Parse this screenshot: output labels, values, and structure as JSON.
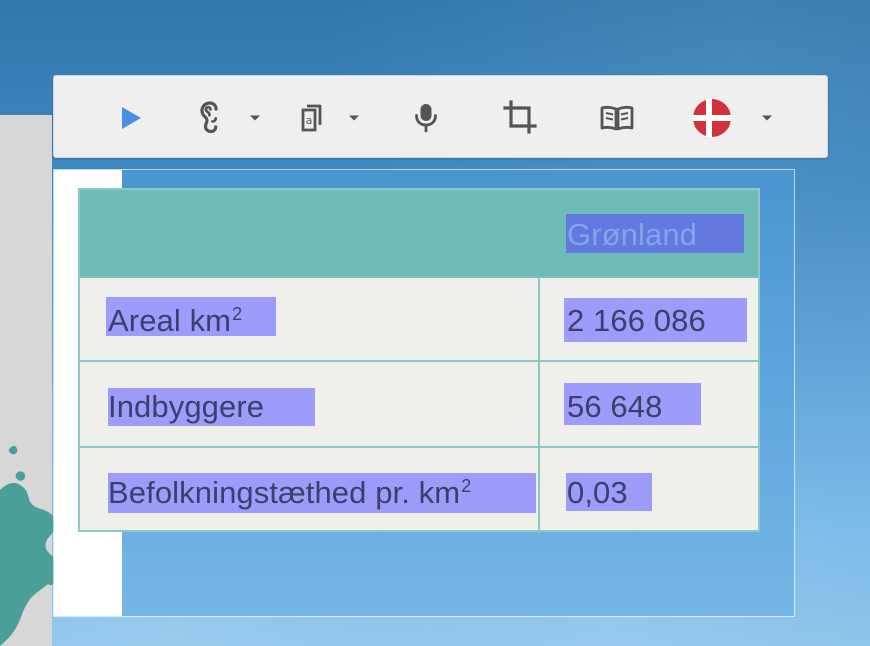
{
  "toolbar": {
    "buttons": [
      {
        "name": "play",
        "icon": "play-icon"
      },
      {
        "name": "hearing",
        "icon": "ear-icon"
      },
      {
        "name": "text-view",
        "icon": "text-document-icon"
      },
      {
        "name": "microphone",
        "icon": "microphone-icon"
      },
      {
        "name": "crop",
        "icon": "crop-icon"
      },
      {
        "name": "dictionary",
        "icon": "book-icon"
      },
      {
        "name": "language",
        "icon": "danish-flag-icon"
      }
    ],
    "colors": {
      "play": "#4a90e2",
      "icon": "#555555",
      "flag_red": "#d0333b",
      "flag_white": "#ffffff"
    }
  },
  "table": {
    "header": {
      "col_1": "",
      "col_2": "Grønland"
    },
    "rows": [
      {
        "label_main": "Areal km",
        "label_sup": "2",
        "value": "2 166 086"
      },
      {
        "label_main": "Indbyggere",
        "label_sup": "",
        "value": "56 648"
      },
      {
        "label_main": "Befolkningstæthed pr. km",
        "label_sup": "2",
        "value": "0,03"
      }
    ],
    "colors": {
      "header_bg": "#6dbcb8",
      "body_bg": "#efefeb",
      "grid": "#8dc6c3",
      "text": "#3a3f6b",
      "highlight": "#7d7bff"
    }
  }
}
